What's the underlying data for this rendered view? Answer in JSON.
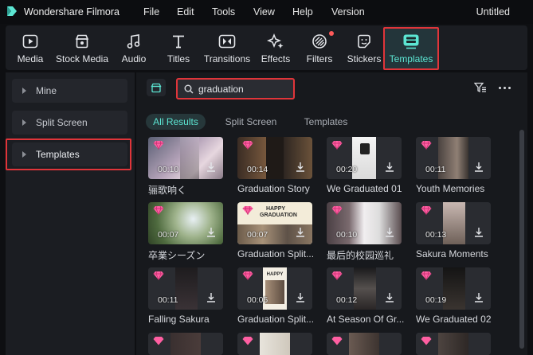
{
  "app": {
    "name": "Wondershare Filmora",
    "window_title": "Untitled"
  },
  "menu": [
    "File",
    "Edit",
    "Tools",
    "View",
    "Help",
    "Version"
  ],
  "toolbar": [
    {
      "label": "Media",
      "icon": "media-icon"
    },
    {
      "label": "Stock Media",
      "icon": "stock-media-icon"
    },
    {
      "label": "Audio",
      "icon": "music-note-icon"
    },
    {
      "label": "Titles",
      "icon": "text-t-icon"
    },
    {
      "label": "Transitions",
      "icon": "transitions-icon"
    },
    {
      "label": "Effects",
      "icon": "effects-sparkle-icon"
    },
    {
      "label": "Filters",
      "icon": "filters-icon",
      "notification_dot": true
    },
    {
      "label": "Stickers",
      "icon": "sticker-icon"
    },
    {
      "label": "Templates",
      "icon": "templates-icon",
      "active": true
    }
  ],
  "sidebar": {
    "items": [
      {
        "label": "Mine"
      },
      {
        "label": "Split Screen"
      },
      {
        "label": "Templates",
        "selected": true
      }
    ]
  },
  "search": {
    "value": "graduation",
    "placeholder": ""
  },
  "filter_tabs": [
    {
      "label": "All Results",
      "active": true
    },
    {
      "label": "Split Screen"
    },
    {
      "label": "Templates"
    }
  ],
  "results": [
    {
      "title": "骊歌响く",
      "duration": "00:10"
    },
    {
      "title": "Graduation Story",
      "duration": "00:14"
    },
    {
      "title": "We Graduated 01",
      "duration": "00:20"
    },
    {
      "title": "Youth Memories",
      "duration": "00:11"
    },
    {
      "title": "卒業シーズン",
      "duration": "00:07"
    },
    {
      "title": "Graduation Split...",
      "duration": "00:07",
      "thumb_text": "HAPPY GRADUATION"
    },
    {
      "title": "最后的校园巡礼",
      "duration": "00:10"
    },
    {
      "title": "Sakura Moments",
      "duration": "00:13"
    },
    {
      "title": "Falling Sakura",
      "duration": "00:11"
    },
    {
      "title": "Graduation Split...",
      "duration": "00:05",
      "thumb_text": "HAPPY"
    },
    {
      "title": "At Season Of Gr...",
      "duration": "00:12"
    },
    {
      "title": "We Graduated 02",
      "duration": "00:19"
    }
  ],
  "colors": {
    "accent": "#5ce6d3",
    "highlight_red": "#e0353a",
    "premium_pink": "#ff5fa2"
  }
}
